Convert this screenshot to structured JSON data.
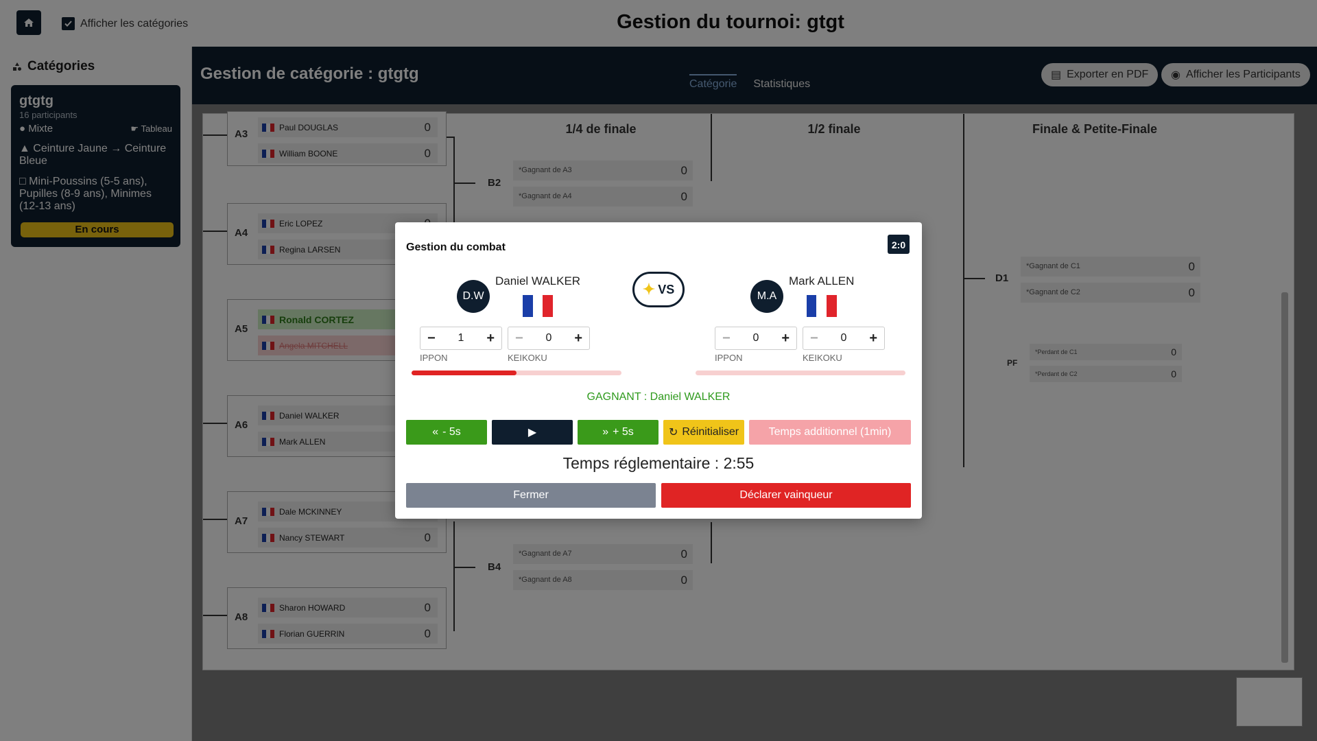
{
  "topbar": {
    "show_categories_label": "Afficher les catégories",
    "page_title": "Gestion du tournoi: gtgt"
  },
  "sidebar": {
    "heading": "Catégories",
    "category": {
      "name": "gtgtg",
      "participants": "16 participants",
      "gender": "Mixte",
      "view": "Tableau",
      "belts": "Ceinture Jaune → Ceinture Bleue",
      "ages": "Mini-Poussins (5-5 ans), Pupilles (8-9 ans), Minimes (12-13 ans)",
      "status": "En cours"
    }
  },
  "category_header": {
    "title": "Gestion de catégorie : gtgtg",
    "tabs": [
      "Catégorie",
      "Statistiques"
    ],
    "export_label": "Exporter en PDF",
    "participants_label": "Afficher les Participants"
  },
  "bracket": {
    "rounds": [
      "1/4 de finale",
      "1/2 finale",
      "Finale & Petite-Finale"
    ],
    "matches": [
      {
        "label": "A3",
        "p1": "Paul DOUGLAS",
        "p2": "William BOONE",
        "s1": "0",
        "s2": "0"
      },
      {
        "label": "A4",
        "p1": "Eric LOPEZ",
        "p2": "Regina LARSEN",
        "s1": "0",
        "s2": "0"
      },
      {
        "label": "A5",
        "p1": "Ronald CORTEZ",
        "p2": "Angela MITCHELL",
        "s1": "",
        "s2": ""
      },
      {
        "label": "A6",
        "p1": "Daniel WALKER",
        "p2": "Mark ALLEN",
        "s1": "",
        "s2": ""
      },
      {
        "label": "A7",
        "p1": "Dale MCKINNEY",
        "p2": "Nancy STEWART",
        "s1": "0",
        "s2": "0"
      },
      {
        "label": "A8",
        "p1": "Sharon HOWARD",
        "p2": "Florian GUERRIN",
        "s1": "0",
        "s2": "0"
      }
    ],
    "quarter": [
      {
        "label": "B2",
        "s1": "*Gagnant de A3",
        "s2": "*Gagnant de A4"
      },
      {
        "label": "B4",
        "s1": "*Gagnant de A7",
        "s2": "*Gagnant de A8"
      }
    ],
    "final": {
      "label": "D1",
      "s1": "*Gagnant de C1",
      "s2": "*Gagnant de C2"
    },
    "small_final": {
      "label": "PF",
      "s1": "*Perdant de C1",
      "s2": "*Perdant de C2"
    },
    "zero": "0"
  },
  "modal": {
    "title": "Gestion du combat",
    "scoreboard_icon": "2:0",
    "fighter1": {
      "initials": "D.W",
      "name": "Daniel WALKER",
      "ippon": "1",
      "keikoku": "0",
      "progress": 0.5
    },
    "fighter2": {
      "initials": "M.A",
      "name": "Mark ALLEN",
      "ippon": "0",
      "keikoku": "0",
      "progress": 0
    },
    "vs_label": "VS",
    "ippon_label": "IPPON",
    "keikoku_label": "KEIKOKU",
    "winner_text": "GAGNANT : Daniel WALKER",
    "minus5_label": "- 5s",
    "plus5_label": "+ 5s",
    "reset_label": "Réinitialiser",
    "extra_time_label": "Temps additionnel (1min)",
    "timer_text": "Temps réglementaire : 2:55",
    "close_label": "Fermer",
    "declare_label": "Déclarer vainqueur"
  },
  "colors": {
    "navy": "#0f1e2e",
    "green": "#3a9a1a",
    "red": "#e02424",
    "yellow": "#f0c419",
    "grey": "#7b8391",
    "pink": "#f5a3a8"
  }
}
